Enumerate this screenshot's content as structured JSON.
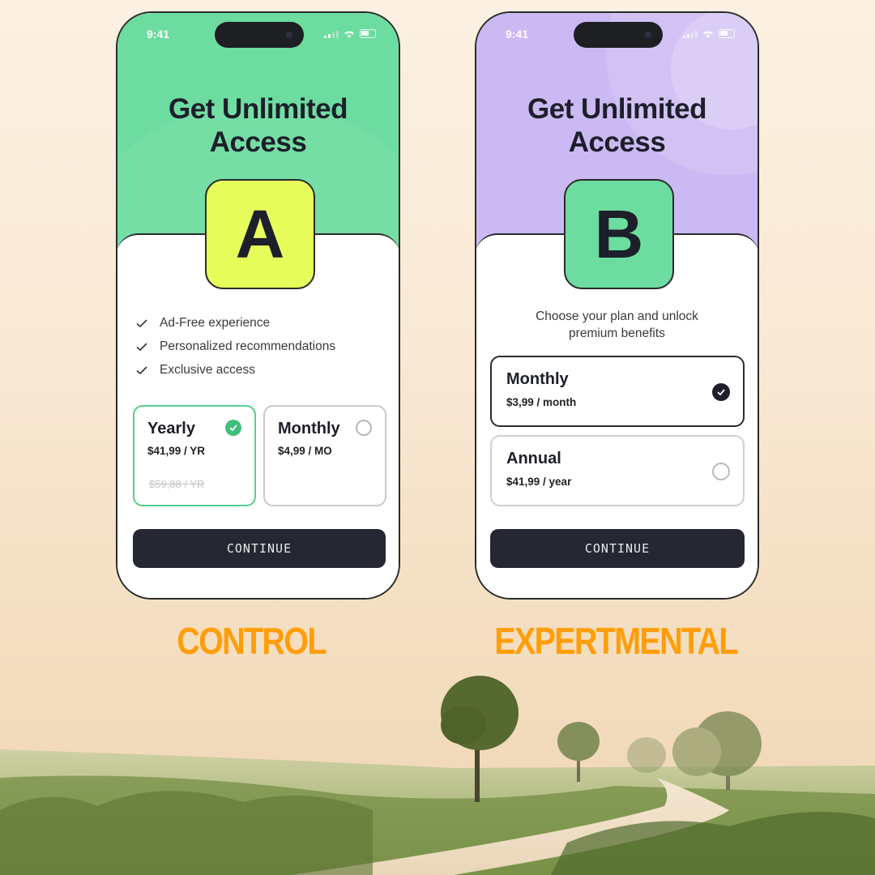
{
  "variants": {
    "a": {
      "status_time": "9:41",
      "headline": "Get Unlimited Access",
      "badge": "A",
      "features": [
        "Ad-Free experience",
        "Personalized recommendations",
        "Exclusive access"
      ],
      "plans": {
        "yearly": {
          "name": "Yearly",
          "price": "$41,99 / YR",
          "old_price": "$59,88 / YR",
          "selected": true
        },
        "monthly": {
          "name": "Monthly",
          "price": "$4,99 / MO",
          "selected": false
        }
      },
      "continue_label": "CONTINUE",
      "label": "CONTROL"
    },
    "b": {
      "status_time": "9:41",
      "headline": "Get Unlimited Access",
      "badge": "B",
      "subtitle": "Choose your plan and unlock premium benefits",
      "plans": {
        "monthly": {
          "name": "Monthly",
          "price": "$3,99 / month",
          "selected": true
        },
        "annual": {
          "name": "Annual",
          "price": "$41,99 / year",
          "selected": false
        }
      },
      "continue_label": "CONTINUE",
      "label": "EXPERTMENTAL"
    }
  },
  "colors": {
    "variant_a_header": "#6cdca0",
    "variant_b_header": "#cbb9f3",
    "badge_a": "#e7fd5c",
    "badge_b": "#6cdca0",
    "selected_green": "#3fbf78",
    "button_dark": "#252833",
    "label_orange": "#ff9e0a"
  }
}
